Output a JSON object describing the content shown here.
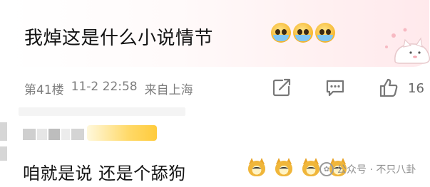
{
  "comment_1": {
    "text": "我焯这是什么小说情节",
    "emojis": [
      "crying-face",
      "crying-face",
      "crying-face"
    ],
    "floor": "第41楼",
    "date": "11-2 22:58",
    "location": "来自上海",
    "like_count": "16"
  },
  "comment_2": {
    "text": "咱就是说 还是个舔狗",
    "emojis": [
      "dog",
      "dog",
      "dog",
      "dog"
    ]
  },
  "watermark": {
    "icon_glyph": "✿",
    "text": "公众号 · 不只八卦"
  },
  "colors": {
    "meta_text": "#7d7d7d",
    "bubble_accent": "#ffe9ec"
  }
}
